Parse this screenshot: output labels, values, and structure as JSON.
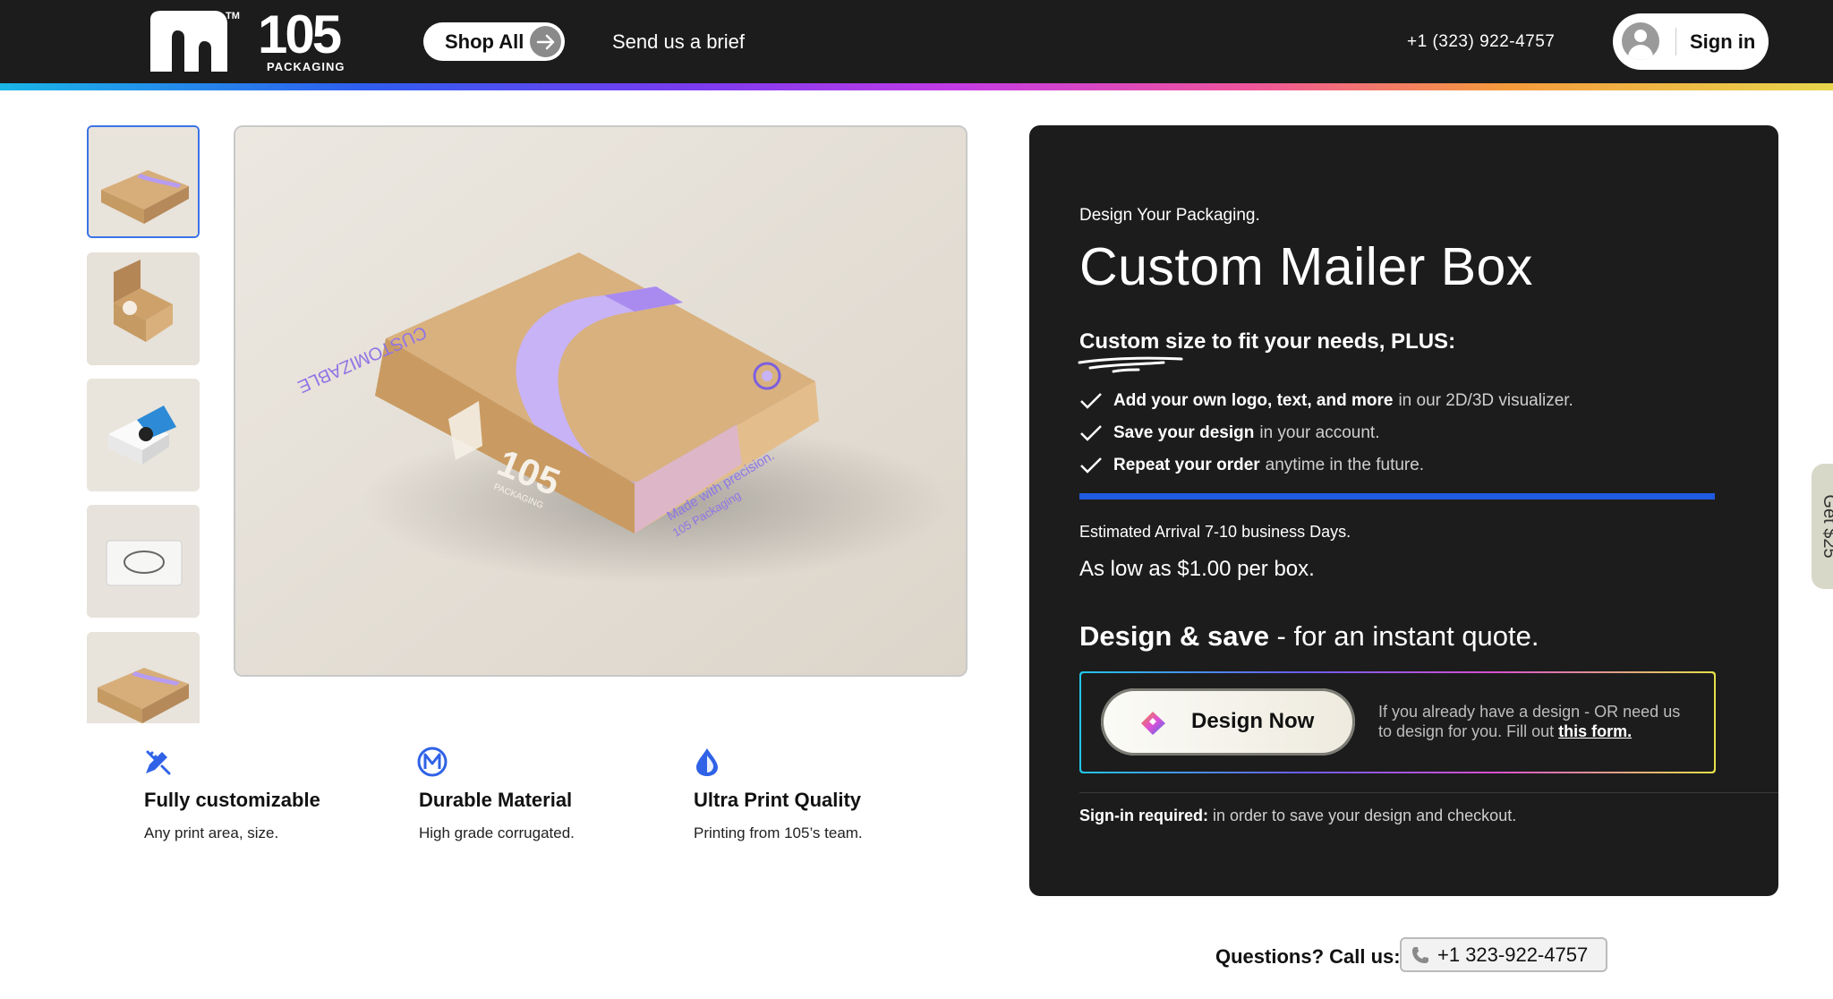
{
  "header": {
    "logo_tm": "TM",
    "logo_number": "105",
    "logo_sub": "PACKAGING",
    "shop_label": "Shop All",
    "brief_label": "Send us a brief",
    "phone": "+1 (323) 922-4757",
    "signin_label": "Sign in"
  },
  "gallery": {
    "thumbnails": [
      "thumb-1",
      "thumb-2",
      "thumb-3",
      "thumb-4",
      "thumb-5"
    ],
    "box_top_text": "CUSTOMIZABLE",
    "box_logo": "105",
    "box_logo_sub": "PACKAGING",
    "box_side_line1": "Made with precision.",
    "box_side_line2": "105 Packaging"
  },
  "features": [
    {
      "title": "Fully customizable",
      "desc": "Any print area, size.",
      "icon": "pencil-ruler-icon"
    },
    {
      "title": "Durable Material",
      "desc": "High grade corrugated.",
      "icon": "material-m-icon"
    },
    {
      "title": "Ultra Print Quality",
      "desc": "Printing from 105’s team.",
      "icon": "ink-drop-icon"
    }
  ],
  "panel": {
    "eyebrow": "Design Your Packaging.",
    "title": "Custom Mailer Box",
    "subtitle_underlined": "Custom size",
    "subtitle_rest": " to fit your needs, PLUS:",
    "benefits": [
      {
        "bold": "Add your own logo, text, and more",
        "rest": "in our 2D/3D visualizer."
      },
      {
        "bold": "Save your design",
        "rest": "in your account."
      },
      {
        "bold": "Repeat your order",
        "rest": "anytime in the future."
      }
    ],
    "arrival": "Estimated Arrival 7-10 business Days.",
    "price": "As low as $1.00 per box.",
    "quote_bold": "Design & save",
    "quote_rest": " - for an instant quote.",
    "design_btn": "Design Now",
    "note_text": "If you already have a design - OR need us to design for you. Fill out ",
    "note_link": "this form.",
    "signreq_bold": "Sign-in required:",
    "signreq_rest": " in order to save your design and checkout."
  },
  "side_tab": "Get $25",
  "footer": {
    "questions": "Questions? Call us:",
    "phone": "+1 323-922-4757"
  },
  "colors": {
    "header_bg": "#1c1c1c",
    "panel_bg": "#1c1c1c",
    "accent_blue": "#1f5be0",
    "box_purple": "#b79cf2",
    "icon_blue": "#2f62e6"
  }
}
